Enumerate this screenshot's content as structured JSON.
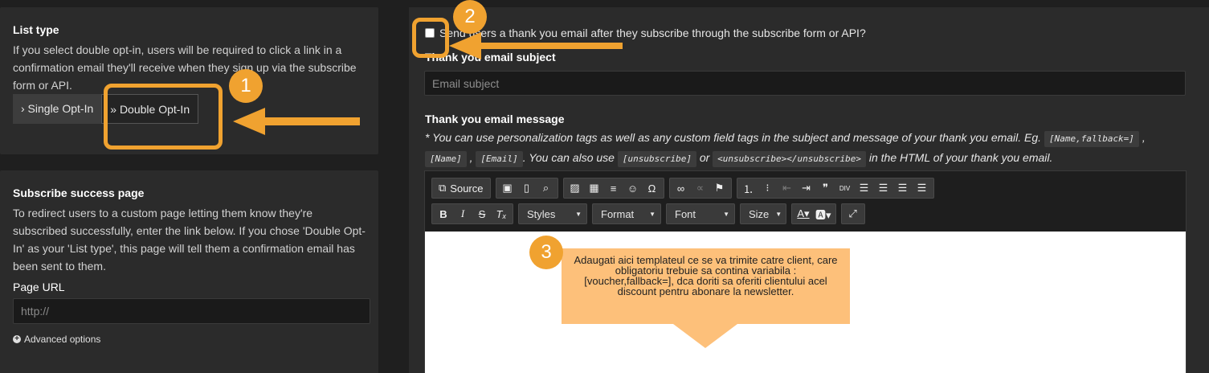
{
  "list_type": {
    "title": "List type",
    "description": "If you select double opt-in, users will be required to click a link in a confirmation email they'll receive when they sign up via the subscribe form or API.",
    "single_label": "› Single Opt-In",
    "double_label": "» Double Opt-In"
  },
  "subscribe_success": {
    "title": "Subscribe success page",
    "description": "To redirect users to a custom page letting them know they're subscribed successfully, enter the link below. If you chose 'Double Opt-In' as your 'List type', this page will tell them a confirmation email has been sent to them.",
    "page_url_label": "Page URL",
    "page_url_placeholder": "http://",
    "advanced_label": "Advanced options"
  },
  "thanks": {
    "checkbox_label": "Send users a thank you email after they subscribe through the subscribe form or API?",
    "checked": false,
    "subject_label": "Thank you email subject",
    "subject_placeholder": "Email subject",
    "message_label": "Thank you email message",
    "note_1": "* You can use personalization tags as well as any custom field tags in the subject and message of your thank you email. Eg.",
    "tag_name_fallback": "[Name,fallback=]",
    "sep_comma": ",",
    "tag_name": "[Name]",
    "tag_email": "[Email]",
    "note_2": ". You can also use",
    "tag_unsubscribe": "[unsubscribe]",
    "note_or": "or",
    "tag_unsubscribe_html": "<unsubscribe></unsubscribe>",
    "note_3": "in the HTML of your thank you email."
  },
  "editor": {
    "source_label": "Source",
    "styles_label": "Styles",
    "format_label": "Format",
    "font_label": "Font",
    "size_label": "Size",
    "icons_row1": [
      "source-icon",
      "save-icon",
      "new-page-icon",
      "preview-icon",
      "image-icon",
      "table-icon",
      "horizontal-line-icon",
      "smiley-icon",
      "special-char-icon",
      "link-icon",
      "unlink-icon",
      "anchor-icon",
      "numbered-list-icon",
      "bulleted-list-icon",
      "outdent-icon",
      "indent-icon",
      "blockquote-icon",
      "div-icon",
      "align-left-icon",
      "align-center-icon",
      "align-right-icon",
      "justify-icon"
    ],
    "icons_row2": [
      "bold-icon",
      "italic-icon",
      "strike-icon",
      "remove-format-icon",
      "text-color-icon",
      "bg-color-icon",
      "maximize-icon"
    ]
  },
  "annotations": {
    "badge_1": "1",
    "badge_2": "2",
    "badge_3": "3",
    "callout_text": "Adaugati aici templateul ce se va trimite catre client, care obligatoriu trebuie sa contina variabila : [voucher,fallback=], dca doriti sa oferiti clientului acel discount pentru abonare la newsletter.",
    "accent_color": "#f0a230",
    "callout_color": "#fdc07a"
  }
}
